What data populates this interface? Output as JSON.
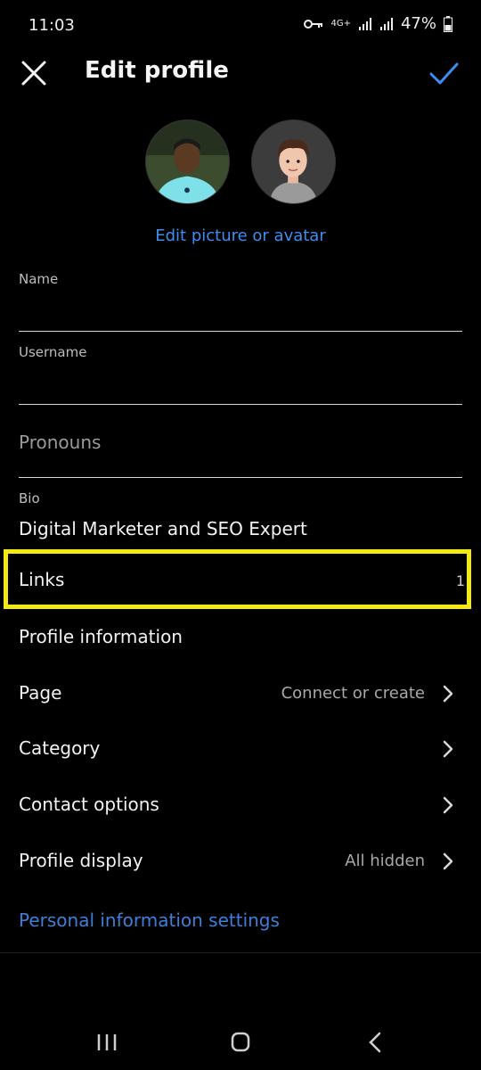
{
  "status_bar": {
    "time": "11:03",
    "network": "4G+",
    "battery": "47%"
  },
  "header": {
    "title": "Edit profile"
  },
  "profile": {
    "edit_picture_label": "Edit picture or avatar"
  },
  "fields": {
    "name_label": "Name",
    "name_value": "",
    "username_label": "Username",
    "username_value": "",
    "pronouns_placeholder": "Pronouns",
    "bio_label": "Bio",
    "bio_value": "Digital Marketer and SEO Expert"
  },
  "links": {
    "label": "Links",
    "count": "1"
  },
  "menu": [
    {
      "label": "Profile information",
      "value": ""
    },
    {
      "label": "Page",
      "value": "Connect or create"
    },
    {
      "label": "Category",
      "value": ""
    },
    {
      "label": "Contact options",
      "value": ""
    },
    {
      "label": "Profile display",
      "value": "All hidden"
    }
  ],
  "personal_info_link": "Personal information settings",
  "colors": {
    "accent_blue": "#3d8ef0",
    "highlight_yellow": "#f3ea12",
    "background": "#000000"
  }
}
